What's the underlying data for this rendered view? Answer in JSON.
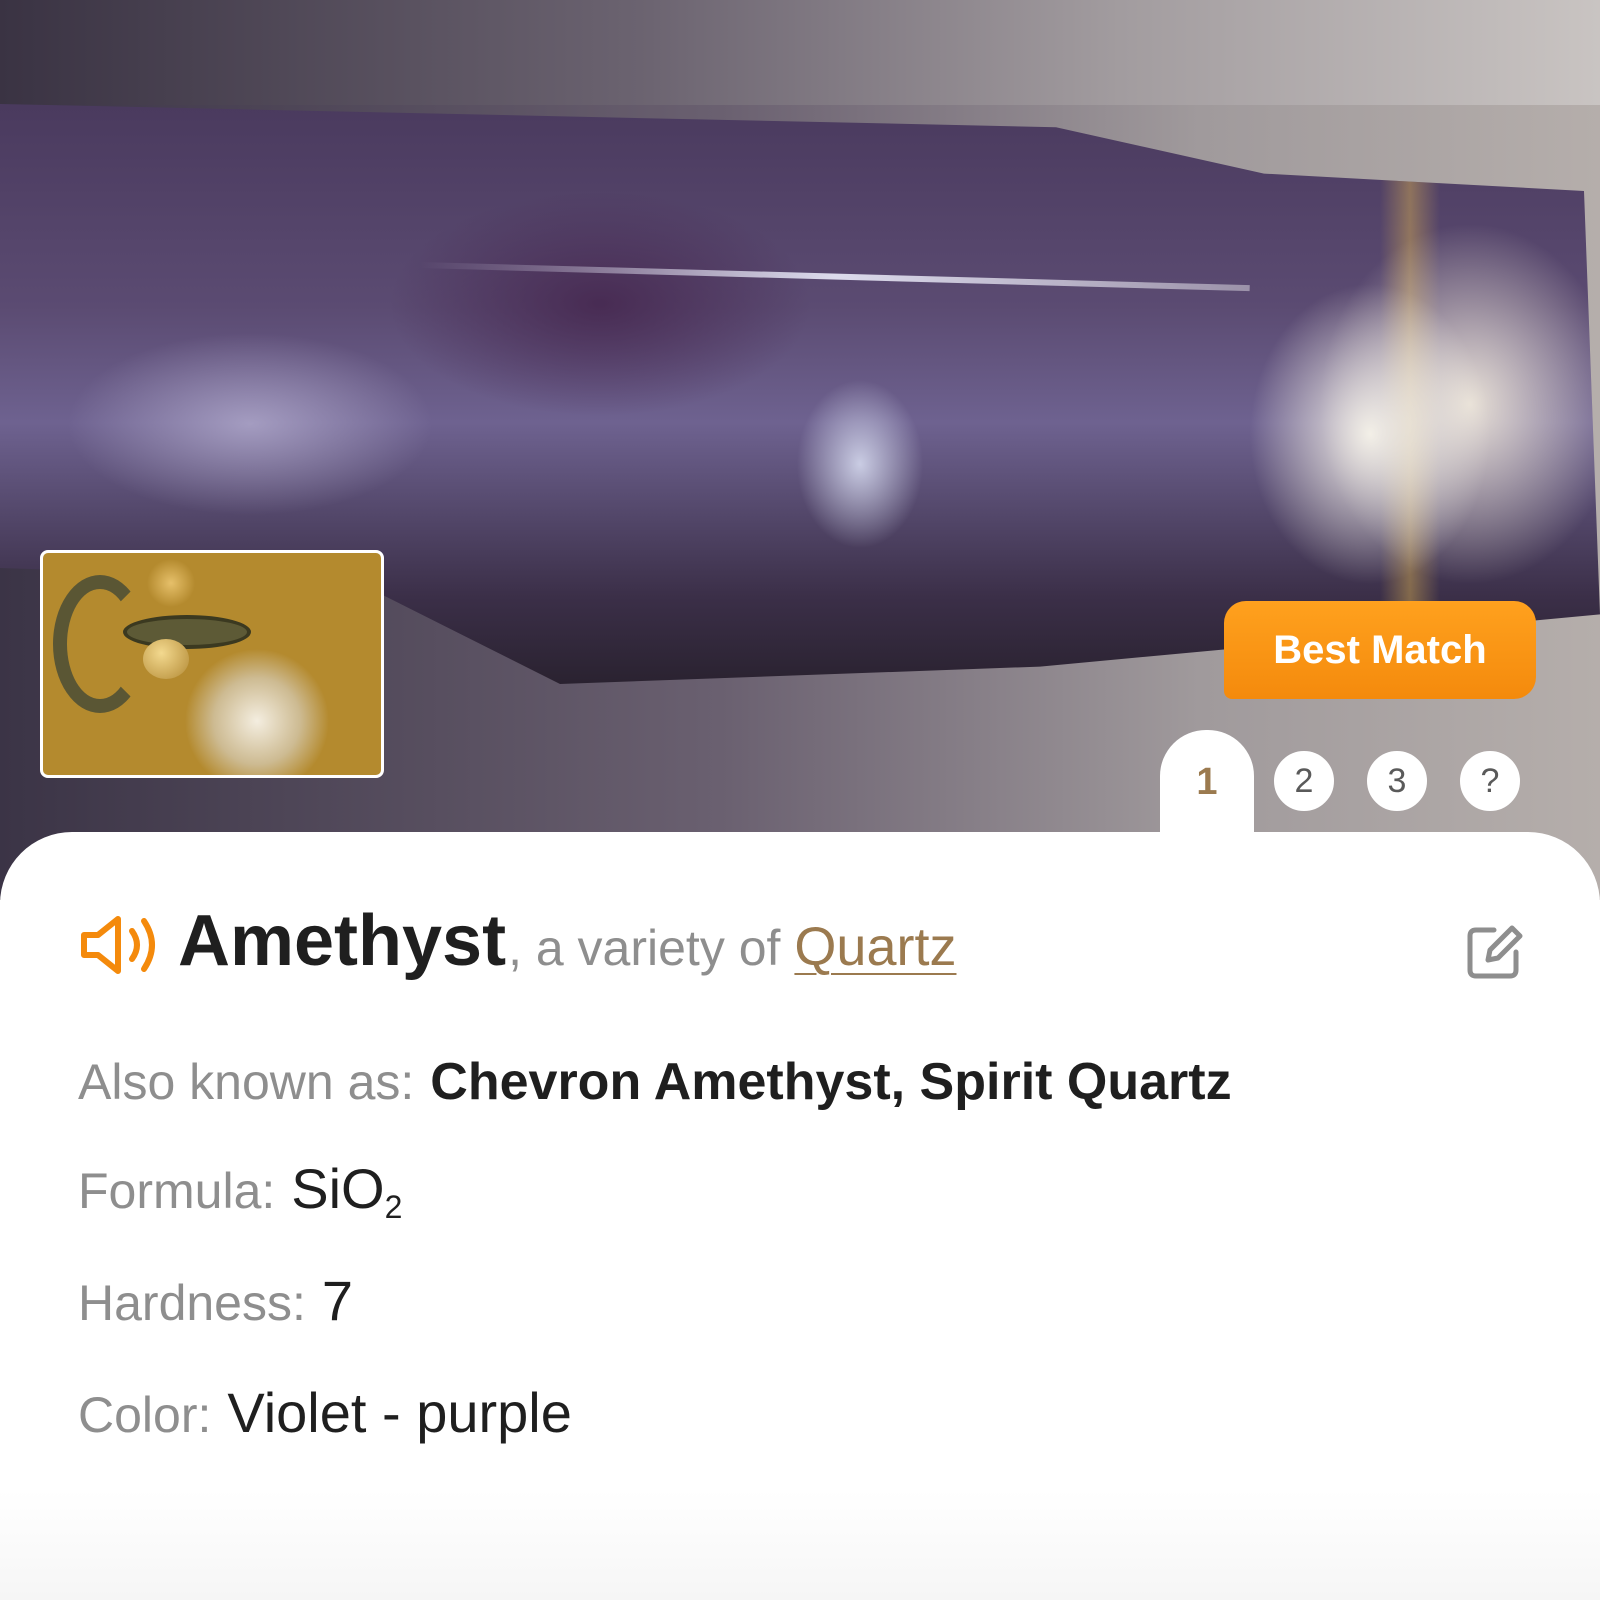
{
  "hero": {
    "best_match_label": "Best Match",
    "result_tabs": [
      "1",
      "2",
      "3",
      "?"
    ],
    "active_tab": "1"
  },
  "result": {
    "name": "Amethyst",
    "variety_text": ", a variety of",
    "parent_mineral": "Quartz"
  },
  "properties": {
    "also_known_as": {
      "label": "Also known as:",
      "value": "Chevron Amethyst, Spirit Quartz"
    },
    "formula": {
      "label": "Formula:",
      "value_main": "SiO",
      "value_sub": "2"
    },
    "hardness": {
      "label": "Hardness:",
      "value": "7"
    },
    "color": {
      "label": "Color:",
      "value": "Violet - purple"
    }
  },
  "icons": {
    "speaker": "speaker-icon",
    "edit": "edit-icon"
  },
  "colors": {
    "accent_orange": "#f48a0c",
    "link_brown": "#9b7a4f",
    "label_gray": "#8e8e8e",
    "text_dark": "#1f1f1f"
  }
}
